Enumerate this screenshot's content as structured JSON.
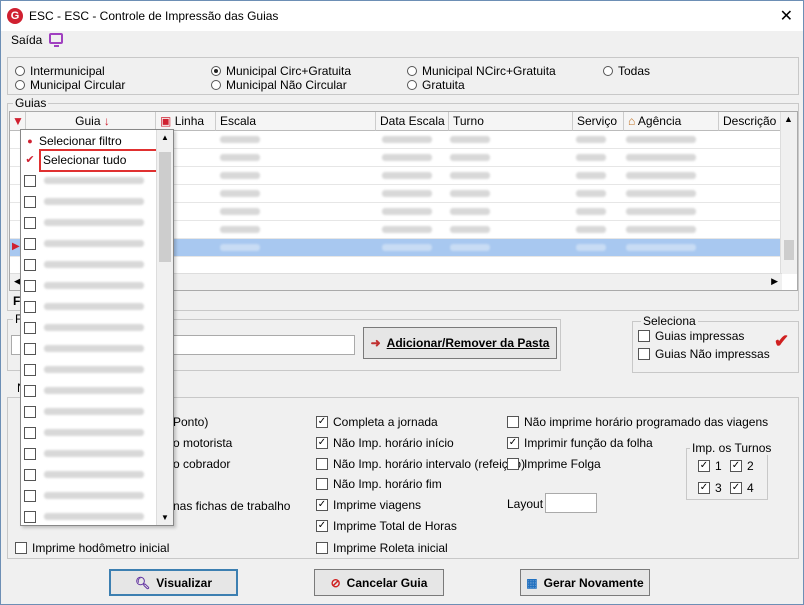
{
  "window": {
    "title": "ESC -  ESC - Controle de Impressão das Guias",
    "close": "✕",
    "app_icon": "G"
  },
  "menu": {
    "saida": "Saída",
    "icon": "monitor-icon"
  },
  "radios": {
    "intermunicipal": "Intermunicipal",
    "municipal_circular": "Municipal Circular",
    "mun_circ_gratuita": "Municipal Circ+Gratuita",
    "mun_nao_circular": "Municipal Não Circular",
    "mun_ncirc_gratuita": "Municipal NCirc+Gratuita",
    "gratuita": "Gratuita",
    "todas": "Todas",
    "selected": "mun_circ_gratuita"
  },
  "guias": {
    "title": "Guias",
    "columns": [
      "Guia",
      "Linha",
      "Escala",
      "Data Escala",
      "Turno",
      "Serviço",
      "Agência",
      "Descrição d"
    ],
    "partial_label": "F"
  },
  "dropdown": {
    "item1": "Selecionar filtro",
    "item2": "Selecionar tudo"
  },
  "pasta": {
    "label": "F",
    "add_button": "Adicionar/Remover da Pasta"
  },
  "seleciona": {
    "title": "Seleciona",
    "impressas": "Guias impressas",
    "nao_impressas": "Guias Não impressas"
  },
  "options": {
    "tab": "N",
    "ponto": "Ponto)",
    "motorista": "o motorista",
    "cobrador": "o cobrador",
    "fichas": "nas fichas de trabalho",
    "hodometro": "Imprime hodômetro inicial",
    "completa_jornada": "Completa a jornada",
    "nao_imp_inicio": "Não Imp. horário início",
    "nao_imp_intervalo": "Não Imp. horário intervalo (refeição)",
    "nao_imp_fim": "Não Imp. horário fim",
    "imprime_viagens": "Imprime viagens",
    "imprime_total": "Imprime Total de Horas",
    "imprime_roleta": "Imprime Roleta inicial",
    "nao_imprime_programado": "Não imprime horário programado das viagens",
    "imprimir_funcao": "Imprimir função da folha",
    "imprime_folga": "Imprime Folga",
    "layout": "Layout",
    "turnos_title": "Imp. os Turnos",
    "t1": "1",
    "t2": "2",
    "t3": "3",
    "t4": "4"
  },
  "buttons": {
    "visualizar": "Visualizar",
    "cancelar": "Cancelar Guia",
    "gerar": "Gerar Novamente"
  }
}
